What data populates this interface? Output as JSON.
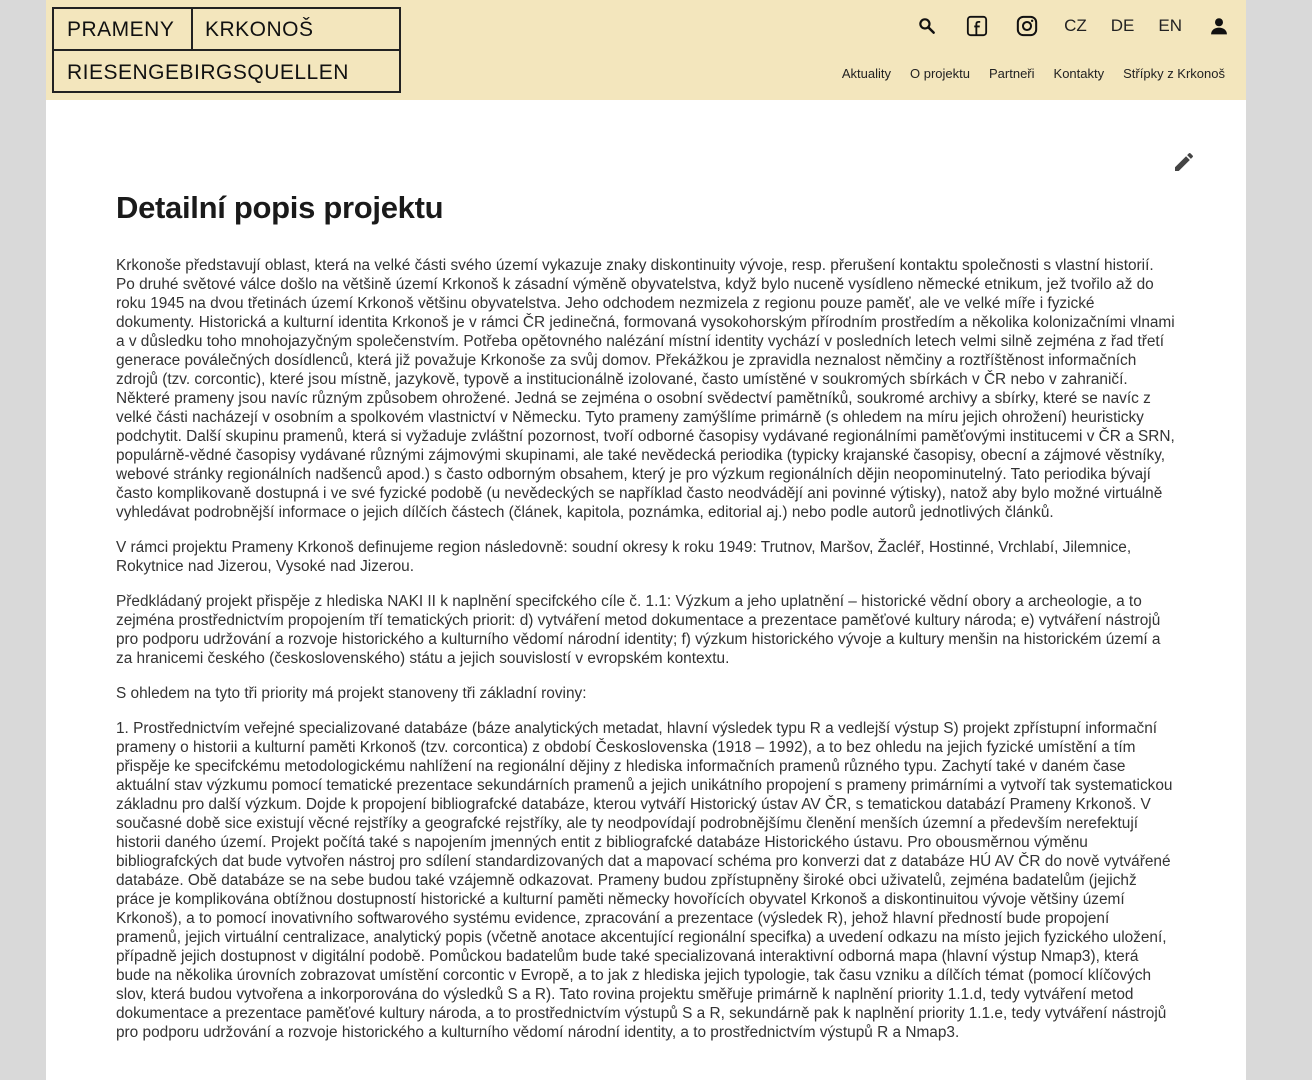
{
  "header": {
    "logo": {
      "word1": "PRAMENY",
      "word2": "KRKONOŠ",
      "word3": "RIESENGEBIRGSQUELLEN"
    },
    "icons": [
      "search-icon",
      "facebook-icon",
      "instagram-icon",
      "user-icon"
    ],
    "languages": [
      "CZ",
      "DE",
      "EN"
    ],
    "nav": [
      "Aktuality",
      "O projektu",
      "Partneři",
      "Kontakty",
      "Střípky z Krkonoš"
    ]
  },
  "main": {
    "title": "Detailní popis projektu",
    "paragraphs": [
      "Krkonoše představují oblast, která na velké části svého území vykazuje znaky diskontinuity vývoje, resp. přerušení kontaktu společnosti s vlastní historií. Po druhé světové válce došlo na většině území Krkonoš k zásadní výměně obyvatelstva, když bylo nuceně vysídleno německé etnikum, jež tvořilo až do roku 1945 na dvou třetinách území Krkonoš většinu obyvatelstva. Jeho odchodem nezmizela z regionu pouze paměť, ale ve velké míře i fyzické dokumenty. Historická a kulturní identita Krkonoš je v rámci ČR jedinečná, formovaná vysokohorským přírodním prostředím a několika kolonizačními vlnami a v důsledku toho mnohojazyčným společenstvím. Potřeba opětovného nalézání místní identity vychází v posledních letech velmi silně zejména z řad třetí generace poválečných dosídlenců, která již považuje Krkonoše za svůj domov. Překážkou je zpravidla neznalost němčiny a roztříštěnost informačních zdrojů (tzv. corcontic), které jsou místně, jazykově, typově a institucionálně izolované, často umístěné v soukromých sbírkách v ČR nebo v zahraničí. Některé prameny jsou navíc různým způsobem ohrožené. Jedná se zejména o osobní svědectví pamětníků, soukromé archivy a sbírky, které se navíc z velké části nacházejí v osobním a spolkovém vlastnictví v Německu. Tyto prameny zamýšlíme primárně (s ohledem na míru jejich ohrožení) heuristicky podchytit. Další skupinu pramenů, která si vyžaduje zvláštní pozornost, tvoří odborné časopisy vydávané regionálními paměťovými institucemi v ČR a SRN, populárně-vědné časopisy vydávané různými zájmovými skupinami, ale také nevědecká periodika (typicky krajanské časopisy, obecní a zájmové věstníky, webové stránky regionálních nadšenců apod.) s často odborným obsahem, který je pro výzkum regionálních dějin neopominutelný. Tato periodika bývají často komplikovaně dostupná i ve své fyzické podobě (u nevědeckých se například často neodvádějí ani povinné výtisky), natož aby bylo možné virtuálně vyhledávat podrobnější informace o jejich dílčích částech (článek, kapitola, poznámka, editorial aj.) nebo podle autorů jednotlivých článků.",
      "V rámci projektu Prameny Krkonoš definujeme region následovně: soudní okresy k roku 1949: Trutnov, Maršov, Žacléř, Hostinné, Vrchlabí, Jilemnice, Rokytnice nad Jizerou, Vysoké nad Jizerou.",
      "Předkládaný projekt přispěje z hlediska NAKI II k naplnění specifckého cíle č. 1.1: Výzkum a jeho uplatnění – historické vědní obory a archeologie, a to zejména prostřednictvím propojením tří tematických priorit: d) vytváření metod dokumentace a prezentace paměťové kultury národa; e) vytváření nástrojů pro podporu udržování a rozvoje historického a kulturního vědomí národní identity; f) výzkum historického vývoje a kultury menšin na historickém území a za hranicemi českého (československého) státu a jejich souvislostí v evropském kontextu.",
      "S ohledem na tyto tři priority má projekt stanoveny tři základní roviny:",
      "1. Prostřednictvím veřejné specializované databáze (báze analytických metadat, hlavní výsledek typu R a vedlejší výstup S) projekt zpřístupní informační prameny o historii a kulturní paměti Krkonoš (tzv. corcontica) z období Československa (1918 – 1992), a to bez ohledu na jejich fyzické umístění a tím přispěje ke specifckému metodologickému nahlížení na regionální dějiny z hlediska informačních pramenů různého typu. Zachytí také v daném čase aktuální stav výzkumu pomocí tematické prezentace sekundárních pramenů a jejich unikátního propojení s prameny primárními a vytvoří tak systematickou základnu pro další výzkum. Dojde k propojení bibliografcké databáze, kterou vytváří Historický ústav AV ČR, s tematickou databází Prameny Krkonoš. V současné době sice existují věcné rejstříky a geografcké rejstříky, ale ty neodpovídají podrobnějšímu členění menších územní a především nerefektují historii daného území. Projekt počítá také s napojením jmenných entit z bibliografcké databáze Historického ústavu. Pro obousměrnou výměnu bibliografckých dat bude vytvořen nástroj pro sdílení standardizovaných dat a mapovací schéma pro konverzi dat z databáze HÚ AV ČR do nově vytvářené databáze. Obě databáze se na sebe budou také vzájemně odkazovat. Prameny budou zpřístupněny široké obci uživatelů, zejména badatelům (jejichž práce je komplikována obtížnou dostupností historické a kulturní paměti německy hovořících obyvatel Krkonoš a diskontinuitou vývoje většiny území Krkonoš), a to pomocí inovativního softwarového systému evidence, zpracování a prezentace (výsledek R), jehož hlavní předností bude propojení pramenů, jejich virtuální centralizace, analytický popis (včetně anotace akcentující regionální specifka) a uvedení odkazu na místo jejich fyzického uložení, případně jejich dostupnost v digitální podobě. Pomůckou badatelům bude také specializovaná interaktivní odborná mapa (hlavní výstup Nmap3), která bude na několika úrovních zobrazovat umístění corcontic v Evropě, a to jak z hlediska jejich typologie, tak času vzniku a dílčích témat (pomocí klíčových slov, která budou vytvořena a inkorporována do výsledků S a R). Tato rovina projektu směřuje primárně k naplnění priority 1.1.d, tedy vytváření metod dokumentace a prezentace paměťové kultury národa, a to prostřednictvím výstupů S a R, sekundárně pak k naplnění priority 1.1.e, tedy vytváření nástrojů pro podporu udržování a rozvoje historického a kulturního vědomí národní identity, a to prostřednictvím výstupů R a Nmap3."
    ]
  }
}
